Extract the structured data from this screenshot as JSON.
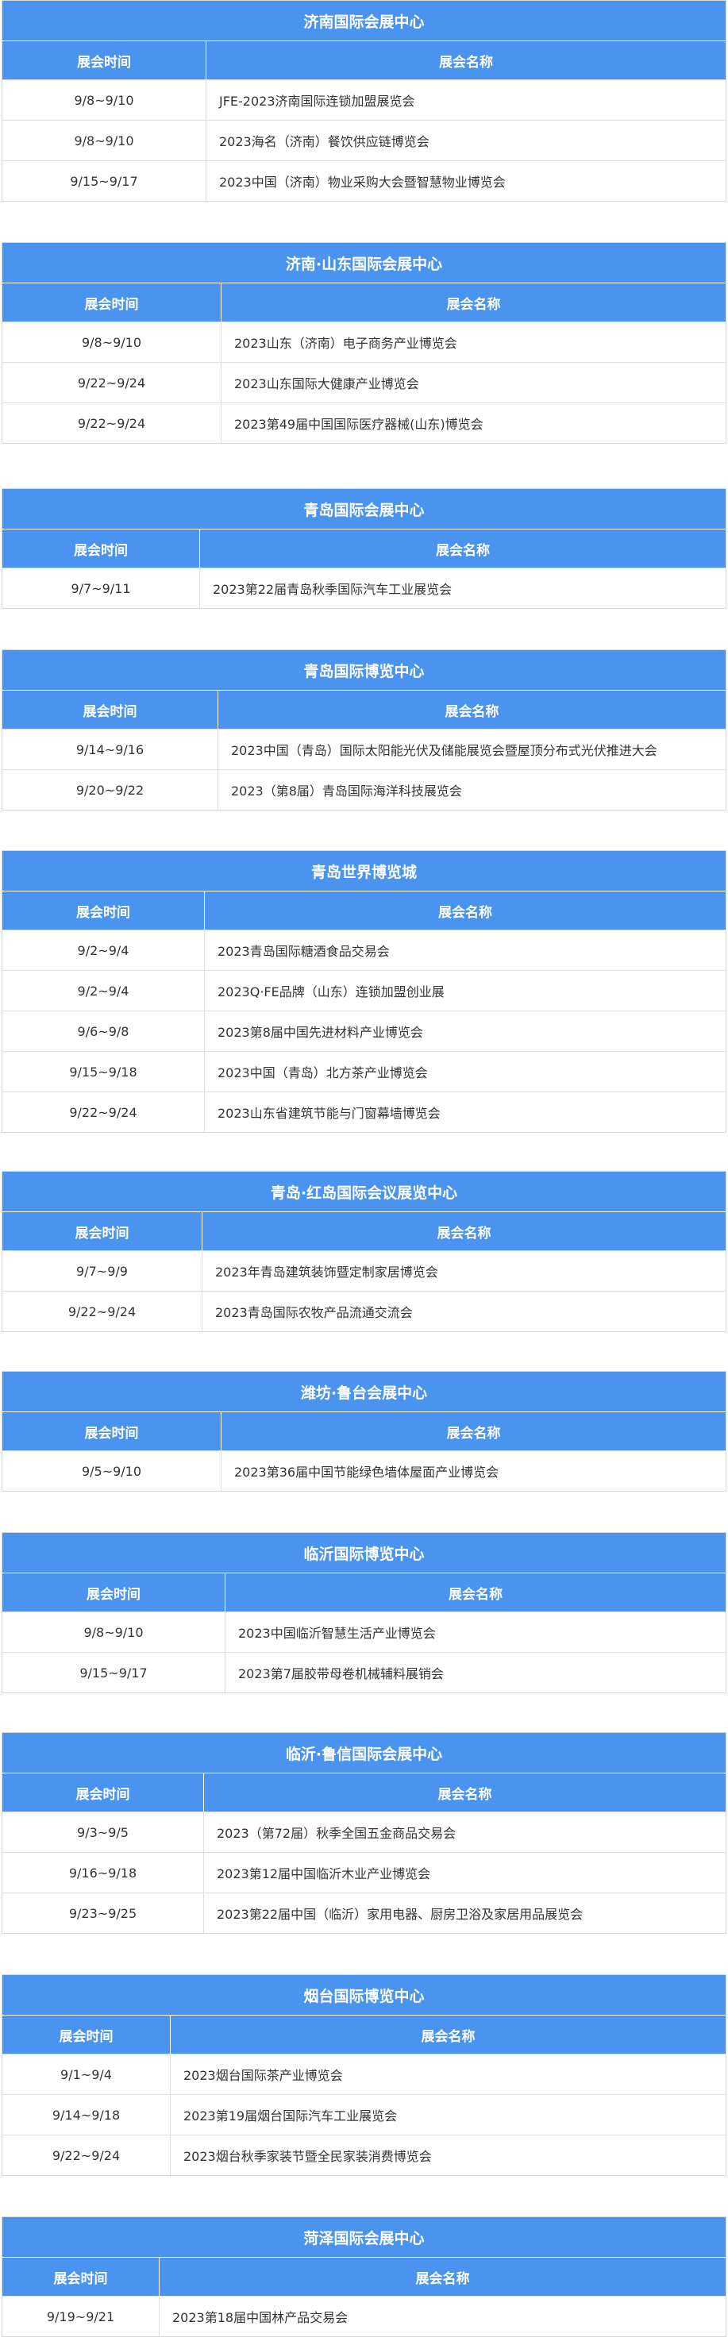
{
  "header": {
    "date_label": "展会时间",
    "name_label": "展会名称"
  },
  "colors": {
    "accent": "#4a93ee",
    "border": "#dedede",
    "text": "#333333"
  },
  "venues": [
    {
      "title": "济南国际会展中心",
      "rows": [
        {
          "date": "9/8~9/10",
          "name": "JFE-2023济南国际连锁加盟展览会"
        },
        {
          "date": "9/8~9/10",
          "name": "2023海名（济南）餐饮供应链博览会"
        },
        {
          "date": "9/15~9/17",
          "name": "2023中国（济南）物业采购大会暨智慧物业博览会"
        }
      ]
    },
    {
      "title": "济南·山东国际会展中心",
      "rows": [
        {
          "date": "9/8~9/10",
          "name": "2023山东（济南）电子商务产业博览会"
        },
        {
          "date": "9/22~9/24",
          "name": "2023山东国际大健康产业博览会"
        },
        {
          "date": "9/22~9/24",
          "name": "2023第49届中国国际医疗器械(山东)博览会"
        }
      ]
    },
    {
      "title": "青岛国际会展中心",
      "rows": [
        {
          "date": "9/7~9/11",
          "name": "2023第22届青岛秋季国际汽车工业展览会"
        }
      ]
    },
    {
      "title": "青岛国际博览中心",
      "rows": [
        {
          "date": "9/14~9/16",
          "name": "2023中国（青岛）国际太阳能光伏及储能展览会暨屋顶分布式光伏推进大会"
        },
        {
          "date": "9/20~9/22",
          "name": "2023（第8届）青岛国际海洋科技展览会"
        }
      ]
    },
    {
      "title": "青岛世界博览城",
      "rows": [
        {
          "date": "9/2~9/4",
          "name": "2023青岛国际糖酒食品交易会"
        },
        {
          "date": "9/2~9/4",
          "name": "2023Q·FE品牌（山东）连锁加盟创业展"
        },
        {
          "date": "9/6~9/8",
          "name": "2023第8届中国先进材料产业博览会"
        },
        {
          "date": "9/15~9/18",
          "name": "2023中国（青岛）北方茶产业博览会"
        },
        {
          "date": "9/22~9/24",
          "name": "2023山东省建筑节能与门窗幕墙博览会"
        }
      ]
    },
    {
      "title": "青岛·红岛国际会议展览中心",
      "rows": [
        {
          "date": "9/7~9/9",
          "name": "2023年青岛建筑装饰暨定制家居博览会"
        },
        {
          "date": "9/22~9/24",
          "name": "2023青岛国际农牧产品流通交流会"
        }
      ]
    },
    {
      "title": "潍坊·鲁台会展中心",
      "rows": [
        {
          "date": "9/5~9/10",
          "name": "2023第36届中国节能绿色墙体屋面产业博览会"
        }
      ]
    },
    {
      "title": "临沂国际博览中心",
      "rows": [
        {
          "date": "9/8~9/10",
          "name": "2023中国临沂智慧生活产业博览会"
        },
        {
          "date": "9/15~9/17",
          "name": "2023第7届胶带母卷机械辅料展销会"
        }
      ]
    },
    {
      "title": "临沂·鲁信国际会展中心",
      "rows": [
        {
          "date": "9/3~9/5",
          "name": "2023（第72届）秋季全国五金商品交易会"
        },
        {
          "date": "9/16~9/18",
          "name": "2023第12届中国临沂木业产业博览会"
        },
        {
          "date": "9/23~9/25",
          "name": "2023第22届中国（临沂）家用电器、厨房卫浴及家居用品展览会"
        }
      ]
    },
    {
      "title": "烟台国际博览中心",
      "rows": [
        {
          "date": "9/1~9/4",
          "name": "2023烟台国际茶产业博览会"
        },
        {
          "date": "9/14~9/18",
          "name": "2023第19届烟台国际汽车工业展览会"
        },
        {
          "date": "9/22~9/24",
          "name": "2023烟台秋季家装节暨全民家装消费博览会"
        }
      ]
    },
    {
      "title": "菏泽国际会展中心",
      "rows": [
        {
          "date": "9/19~9/21",
          "name": "2023第18届中国林产品交易会"
        }
      ]
    }
  ]
}
